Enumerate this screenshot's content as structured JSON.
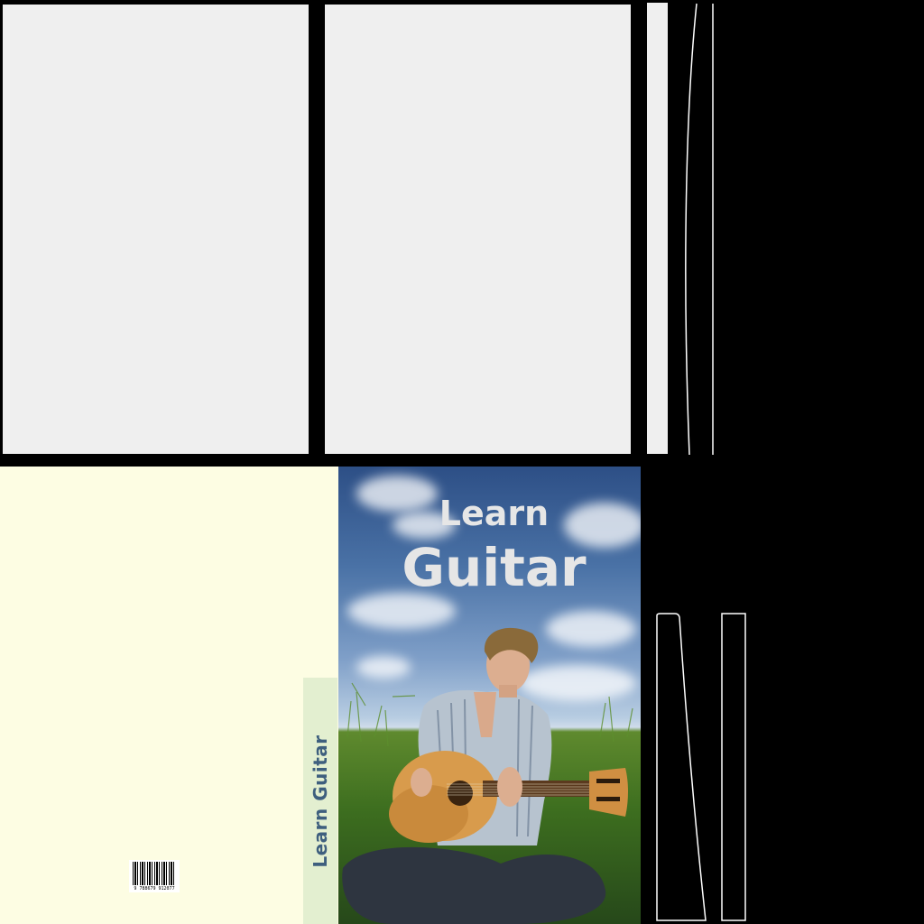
{
  "cover_title": {
    "line1": "Learn",
    "line2": "Guitar"
  },
  "spine": {
    "title": "Learn Guitar"
  },
  "barcode": {
    "digits": "9 788679 912077"
  },
  "colors": {
    "background": "#000000",
    "page_panel": "#efefef",
    "back_cover": "#fdfde3",
    "spine_strip": "#e3efd0",
    "spine_text": "#3e5f7e",
    "cover_title_text": "#e6e6e6",
    "outline": "#ffffff"
  },
  "icons": {
    "barcode": "barcode-icon",
    "photo": "guitarist-in-field-photo"
  }
}
